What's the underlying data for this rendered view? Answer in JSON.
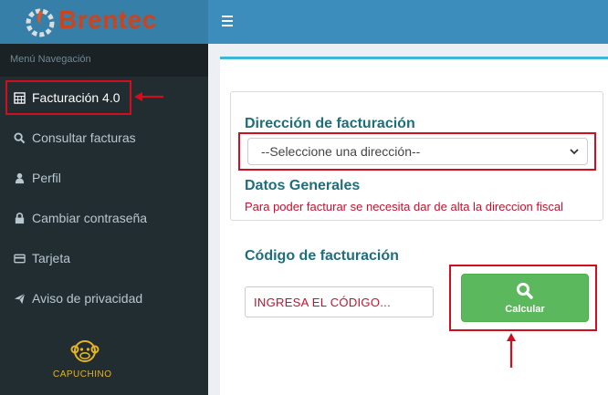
{
  "brand": {
    "name": "Brentec",
    "footer_label": "CAPUCHINO"
  },
  "sidebar": {
    "header": "Menú Navegación",
    "items": [
      {
        "label": "Facturación 4.0",
        "icon": "calculator-icon"
      },
      {
        "label": "Consultar facturas",
        "icon": "search-icon"
      },
      {
        "label": "Perfil",
        "icon": "user-icon"
      },
      {
        "label": "Cambiar contraseña",
        "icon": "lock-icon"
      },
      {
        "label": "Tarjeta",
        "icon": "credit-card-icon"
      },
      {
        "label": "Aviso de privacidad",
        "icon": "paper-plane-icon"
      }
    ]
  },
  "topbar": {
    "menu_icon": "hamburger-icon"
  },
  "billing": {
    "address_title": "Dirección de facturación",
    "address_select_value": "--Seleccione una dirección--",
    "general_title": "Datos Generales",
    "warning": "Para poder facturar se necesita dar de alta la direccion fiscal",
    "code_title": "Código de facturación",
    "code_placeholder": "INGRESA EL CÓDIGO...",
    "calc_button": "Calcular"
  },
  "colors": {
    "sidebar_bg": "#222d32",
    "topbar_bg": "#3c8dbc",
    "logo_bg": "#367fa9",
    "accent_teal": "#1f6e7c",
    "warning_red": "#c8102e",
    "button_green": "#5cb85c",
    "highlight_red": "#d10e1e"
  }
}
